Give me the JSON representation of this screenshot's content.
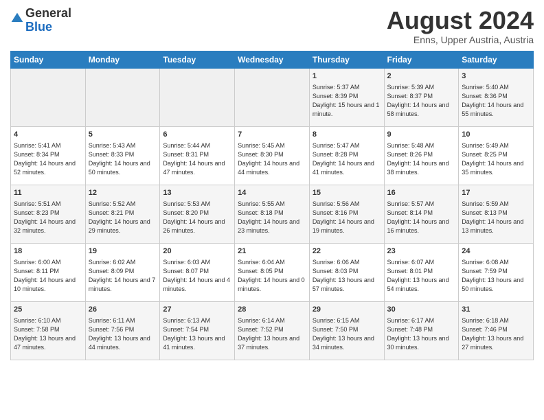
{
  "header": {
    "logo_general": "General",
    "logo_blue": "Blue",
    "month_title": "August 2024",
    "location": "Enns, Upper Austria, Austria"
  },
  "days_of_week": [
    "Sunday",
    "Monday",
    "Tuesday",
    "Wednesday",
    "Thursday",
    "Friday",
    "Saturday"
  ],
  "weeks": [
    [
      {
        "day": "",
        "empty": true
      },
      {
        "day": "",
        "empty": true
      },
      {
        "day": "",
        "empty": true
      },
      {
        "day": "",
        "empty": true
      },
      {
        "day": "1",
        "sunrise": "5:37 AM",
        "sunset": "8:39 PM",
        "daylight": "15 hours and 1 minute."
      },
      {
        "day": "2",
        "sunrise": "5:39 AM",
        "sunset": "8:37 PM",
        "daylight": "14 hours and 58 minutes."
      },
      {
        "day": "3",
        "sunrise": "5:40 AM",
        "sunset": "8:36 PM",
        "daylight": "14 hours and 55 minutes."
      }
    ],
    [
      {
        "day": "4",
        "sunrise": "5:41 AM",
        "sunset": "8:34 PM",
        "daylight": "14 hours and 52 minutes."
      },
      {
        "day": "5",
        "sunrise": "5:43 AM",
        "sunset": "8:33 PM",
        "daylight": "14 hours and 50 minutes."
      },
      {
        "day": "6",
        "sunrise": "5:44 AM",
        "sunset": "8:31 PM",
        "daylight": "14 hours and 47 minutes."
      },
      {
        "day": "7",
        "sunrise": "5:45 AM",
        "sunset": "8:30 PM",
        "daylight": "14 hours and 44 minutes."
      },
      {
        "day": "8",
        "sunrise": "5:47 AM",
        "sunset": "8:28 PM",
        "daylight": "14 hours and 41 minutes."
      },
      {
        "day": "9",
        "sunrise": "5:48 AM",
        "sunset": "8:26 PM",
        "daylight": "14 hours and 38 minutes."
      },
      {
        "day": "10",
        "sunrise": "5:49 AM",
        "sunset": "8:25 PM",
        "daylight": "14 hours and 35 minutes."
      }
    ],
    [
      {
        "day": "11",
        "sunrise": "5:51 AM",
        "sunset": "8:23 PM",
        "daylight": "14 hours and 32 minutes."
      },
      {
        "day": "12",
        "sunrise": "5:52 AM",
        "sunset": "8:21 PM",
        "daylight": "14 hours and 29 minutes."
      },
      {
        "day": "13",
        "sunrise": "5:53 AM",
        "sunset": "8:20 PM",
        "daylight": "14 hours and 26 minutes."
      },
      {
        "day": "14",
        "sunrise": "5:55 AM",
        "sunset": "8:18 PM",
        "daylight": "14 hours and 23 minutes."
      },
      {
        "day": "15",
        "sunrise": "5:56 AM",
        "sunset": "8:16 PM",
        "daylight": "14 hours and 19 minutes."
      },
      {
        "day": "16",
        "sunrise": "5:57 AM",
        "sunset": "8:14 PM",
        "daylight": "14 hours and 16 minutes."
      },
      {
        "day": "17",
        "sunrise": "5:59 AM",
        "sunset": "8:13 PM",
        "daylight": "14 hours and 13 minutes."
      }
    ],
    [
      {
        "day": "18",
        "sunrise": "6:00 AM",
        "sunset": "8:11 PM",
        "daylight": "14 hours and 10 minutes."
      },
      {
        "day": "19",
        "sunrise": "6:02 AM",
        "sunset": "8:09 PM",
        "daylight": "14 hours and 7 minutes."
      },
      {
        "day": "20",
        "sunrise": "6:03 AM",
        "sunset": "8:07 PM",
        "daylight": "14 hours and 4 minutes."
      },
      {
        "day": "21",
        "sunrise": "6:04 AM",
        "sunset": "8:05 PM",
        "daylight": "14 hours and 0 minutes."
      },
      {
        "day": "22",
        "sunrise": "6:06 AM",
        "sunset": "8:03 PM",
        "daylight": "13 hours and 57 minutes."
      },
      {
        "day": "23",
        "sunrise": "6:07 AM",
        "sunset": "8:01 PM",
        "daylight": "13 hours and 54 minutes."
      },
      {
        "day": "24",
        "sunrise": "6:08 AM",
        "sunset": "7:59 PM",
        "daylight": "13 hours and 50 minutes."
      }
    ],
    [
      {
        "day": "25",
        "sunrise": "6:10 AM",
        "sunset": "7:58 PM",
        "daylight": "13 hours and 47 minutes."
      },
      {
        "day": "26",
        "sunrise": "6:11 AM",
        "sunset": "7:56 PM",
        "daylight": "13 hours and 44 minutes."
      },
      {
        "day": "27",
        "sunrise": "6:13 AM",
        "sunset": "7:54 PM",
        "daylight": "13 hours and 41 minutes."
      },
      {
        "day": "28",
        "sunrise": "6:14 AM",
        "sunset": "7:52 PM",
        "daylight": "13 hours and 37 minutes."
      },
      {
        "day": "29",
        "sunrise": "6:15 AM",
        "sunset": "7:50 PM",
        "daylight": "13 hours and 34 minutes."
      },
      {
        "day": "30",
        "sunrise": "6:17 AM",
        "sunset": "7:48 PM",
        "daylight": "13 hours and 30 minutes."
      },
      {
        "day": "31",
        "sunrise": "6:18 AM",
        "sunset": "7:46 PM",
        "daylight": "13 hours and 27 minutes."
      }
    ]
  ]
}
